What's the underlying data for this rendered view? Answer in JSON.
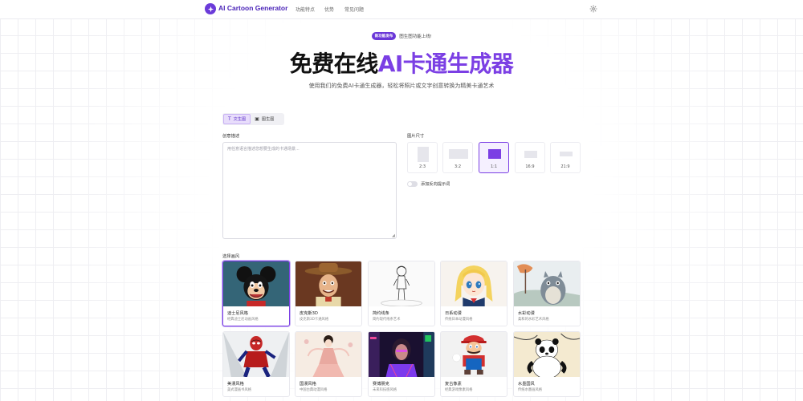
{
  "header": {
    "brand": "AI Cartoon Generator",
    "nav": [
      "功能特点",
      "优势",
      "常见问题"
    ],
    "settings_icon": "gear-icon"
  },
  "hero": {
    "badge": "新功能发布",
    "badge_text": "图生图功能上线!",
    "title_plain": "免费在线",
    "title_accent": "AI卡通生成器",
    "subtitle": "使用我们的免费AI卡通生成器，轻松将照片或文字创意转换为精美卡通艺术"
  },
  "mode_tabs": [
    {
      "label": "文生图",
      "icon": "text-icon",
      "active": true
    },
    {
      "label": "图生图",
      "icon": "image-icon",
      "active": false
    }
  ],
  "prompt": {
    "label": "创意描述",
    "placeholder": "用任意语言描述您想要生成的卡通场景..."
  },
  "image_size": {
    "label": "图片尺寸",
    "options": [
      "2:3",
      "3:2",
      "1:1",
      "16:9",
      "21:9"
    ],
    "selected": "1:1"
  },
  "negative_prompt_toggle": {
    "label": "添加反向提示词",
    "on": false
  },
  "styles": {
    "label": "选择画风",
    "items": [
      {
        "name": "迪士尼风格",
        "desc": "经典迪士尼动画风格",
        "selected": true,
        "icon": "mouse-character-thumbnail"
      },
      {
        "name": "皮克斯3D",
        "desc": "皮克斯3D卡通风格",
        "selected": false,
        "icon": "cowboy-character-thumbnail"
      },
      {
        "name": "简约线条",
        "desc": "简约现代线条艺术",
        "selected": false,
        "icon": "line-art-thumbnail"
      },
      {
        "name": "日系动漫",
        "desc": "传统日本动漫风格",
        "selected": false,
        "icon": "anime-girl-thumbnail"
      },
      {
        "name": "水彩动漫",
        "desc": "柔和的水彩艺术风格",
        "selected": false,
        "icon": "watercolor-creature-thumbnail"
      },
      {
        "name": "美漫风格",
        "desc": "美式漫画书风格",
        "selected": false,
        "icon": "superhero-thumbnail"
      },
      {
        "name": "国漫风格",
        "desc": "中国古典动漫风格",
        "selected": false,
        "icon": "chinese-dancer-thumbnail"
      },
      {
        "name": "赛博朋克",
        "desc": "未来科技感风格",
        "selected": false,
        "icon": "cyberpunk-thumbnail"
      },
      {
        "name": "复古像素",
        "desc": "经典游戏像素风格",
        "selected": false,
        "icon": "plumber-thumbnail"
      },
      {
        "name": "水墨国风",
        "desc": "传统水墨画风格",
        "selected": false,
        "icon": "panda-thumbnail"
      }
    ]
  },
  "colors": {
    "accent": "#7b3fe4",
    "brand": "#4a23b8"
  }
}
